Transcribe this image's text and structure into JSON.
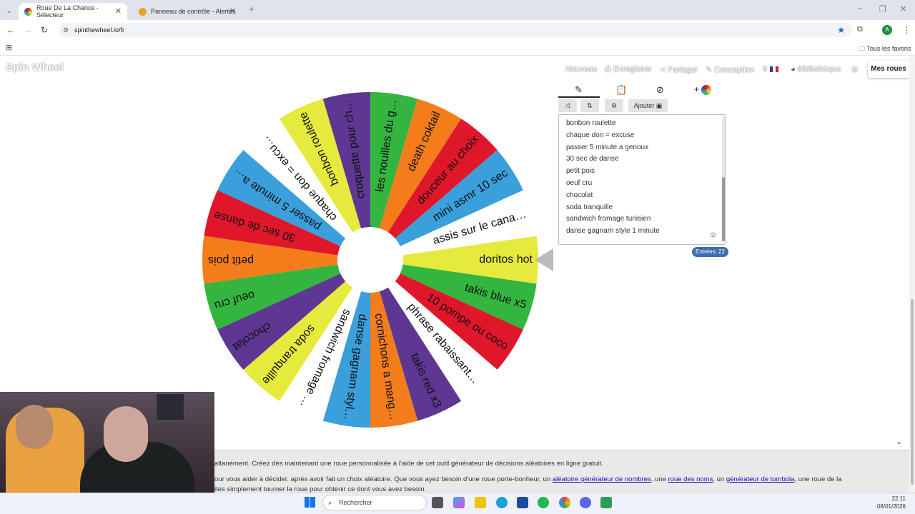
{
  "browser": {
    "tabs": [
      {
        "label": "Roue De La Chance - Sélecteur",
        "active": true
      },
      {
        "label": "Panneau de contrôle - Alertes",
        "active": false
      }
    ],
    "url": "spinthewheel.io/fr",
    "bookmarks_label": "Tous les favoris",
    "profile_letter": "A"
  },
  "site": {
    "logo": "Spin Wheel",
    "nav": {
      "nouveau": "Nouveau",
      "enregistrer": "Enregistrer",
      "partager": "Partager",
      "conception": "Conception",
      "lang": "fr",
      "bibliotheque": "Bibliothèque",
      "mes_roues": "Mes roues"
    }
  },
  "panel": {
    "ajouter": "Ajouter",
    "entries": [
      "bonbon roulette",
      "chaque don = excuse",
      "passer 5 minute a genoux",
      "30 sec de danse",
      "petit pois",
      "oeuf cru",
      "chocolat",
      "soda tranquille",
      "sandwich fromage tunisien",
      "danse gagnam style 1 minute"
    ],
    "count": "Entrées: 22"
  },
  "wheel": {
    "colors": {
      "green": "#33b540",
      "orange": "#f37d1b",
      "red": "#e0172a",
      "blue": "#3a9fdb",
      "white": "#ffffff",
      "yellow": "#e6ea3c",
      "purple": "#5d3792"
    },
    "segments": [
      {
        "label": "doritos hot",
        "color": "yellow"
      },
      {
        "label": "takis blue x5",
        "color": "green"
      },
      {
        "label": "10 pompe ou coco",
        "color": "red"
      },
      {
        "label": "phrase rabaissant…",
        "color": "white"
      },
      {
        "label": "takis red x3",
        "color": "purple"
      },
      {
        "label": "cornichons a mang…",
        "color": "orange"
      },
      {
        "label": "danse gagnam styl…",
        "color": "blue"
      },
      {
        "label": "sandwich fromage …",
        "color": "white"
      },
      {
        "label": "soda tranquille",
        "color": "yellow"
      },
      {
        "label": "chocolat",
        "color": "purple"
      },
      {
        "label": "oeuf cru",
        "color": "green"
      },
      {
        "label": "petit pois",
        "color": "orange"
      },
      {
        "label": "30 sec de danse",
        "color": "red"
      },
      {
        "label": "passer 5 minute a…",
        "color": "blue"
      },
      {
        "label": "chaque don = excu…",
        "color": "white"
      },
      {
        "label": "bonbon roulette",
        "color": "yellow"
      },
      {
        "label": "croquette pour ch…",
        "color": "purple"
      },
      {
        "label": "les nouilles du g…",
        "color": "green"
      },
      {
        "label": "death coktail",
        "color": "orange"
      },
      {
        "label": "douceur au choix",
        "color": "red"
      },
      {
        "label": "mini asmr 10 sec",
        "color": "blue"
      },
      {
        "label": "assis sur le cana…",
        "color": "white"
      }
    ]
  },
  "footer": {
    "line1": "altanément. Créez dès maintenant une roue personnalisée à l'aide de cet outil générateur de décisions aléatoires en ligne gratuit.",
    "line2_a": "our vous aider à décider. après avoir fait un choix aléatoire. Que vous ayez besoin d'une roue porte-bonheur, un ",
    "link1": "aléatoire générateur de nombres",
    "line2_b": ", une ",
    "link2": "roue des noms",
    "line2_c": ", un ",
    "link3": "générateur de tombola",
    "line2_d": ", une roue de la",
    "line3": "ites simplement tourner la roue pour obtenir ce dont vous avez besoin."
  },
  "taskbar": {
    "search": "Rechercher",
    "time": "22:11",
    "date": "08/01/2026"
  }
}
